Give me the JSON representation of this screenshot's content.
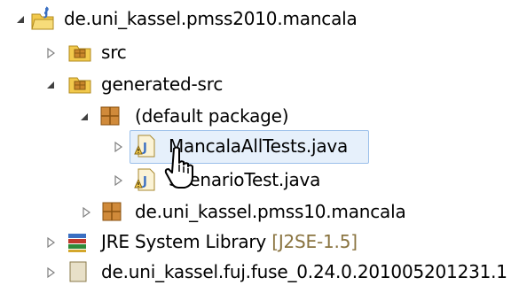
{
  "tree": {
    "project": {
      "label": "de.uni_kassel.pmss2010.mancala",
      "icon": "java-project-icon"
    },
    "src": {
      "label": "src",
      "icon": "source-folder-icon"
    },
    "generated_src": {
      "label": "generated-src",
      "icon": "source-folder-icon"
    },
    "default_package": {
      "label": "(default package)",
      "icon": "package-icon"
    },
    "file1": {
      "label": "MancalaAllTests.java",
      "icon": "java-file-icon"
    },
    "file2": {
      "label": "ScenarioTest.java",
      "icon": "java-file-icon"
    },
    "package2": {
      "label": "de.uni_kassel.pmss10.mancala",
      "icon": "package-icon"
    },
    "jre": {
      "label": "JRE System Library",
      "decoration": "[J2SE-1.5]",
      "icon": "library-icon"
    },
    "partial": {
      "label": "de.uni_kassel.fuj.fuse_0.24.0.201005201231.1",
      "icon": "jar-icon"
    }
  },
  "colors": {
    "selection_fill": "#e6f0fb",
    "selection_border": "#9cc0ea",
    "decoration_text": "#8a7440"
  }
}
